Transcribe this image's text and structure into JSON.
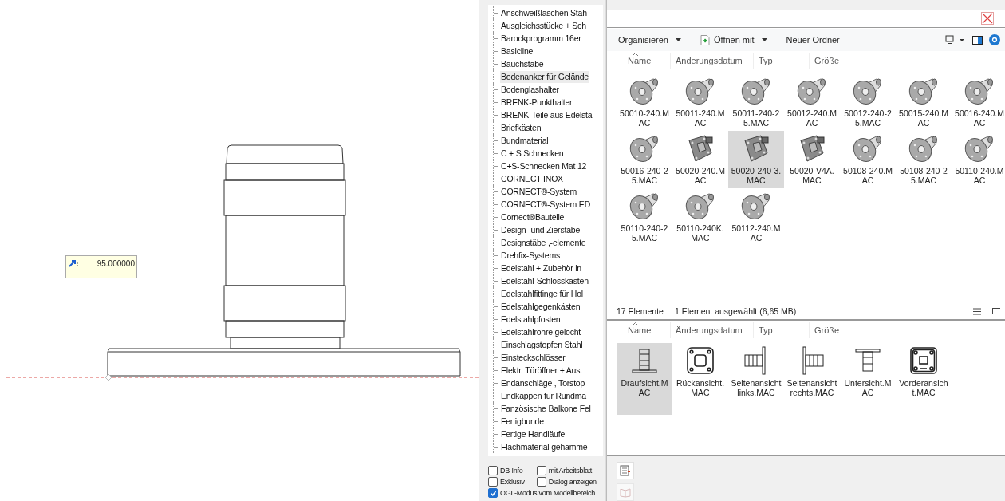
{
  "cad_view": {
    "input_tooltip": {
      "value": "95.000000"
    }
  },
  "tree": {
    "items": [
      {
        "label": "Anschweißlaschen Stah",
        "selected": false
      },
      {
        "label": "Ausgleichsstücke + Sch",
        "selected": false
      },
      {
        "label": "Barockprogramm 16er",
        "selected": false
      },
      {
        "label": "Basicline",
        "selected": false
      },
      {
        "label": "Bauchstäbe",
        "selected": false
      },
      {
        "label": "Bodenanker für Gelände",
        "selected": true
      },
      {
        "label": "Bodenglashalter",
        "selected": false
      },
      {
        "label": "BRENK-Punkthalter",
        "selected": false
      },
      {
        "label": "BRENK-Teile aus Edelsta",
        "selected": false
      },
      {
        "label": "Briefkästen",
        "selected": false
      },
      {
        "label": "Bundmaterial",
        "selected": false
      },
      {
        "label": "C + S Schnecken",
        "selected": false
      },
      {
        "label": "C+S-Schnecken Mat 12",
        "selected": false
      },
      {
        "label": "CORNECT INOX",
        "selected": false
      },
      {
        "label": "CORNECT®-System",
        "selected": false
      },
      {
        "label": "CORNECT®-System ED",
        "selected": false
      },
      {
        "label": "Cornect®Bauteile",
        "selected": false
      },
      {
        "label": "Design- und Zierstäbe",
        "selected": false
      },
      {
        "label": "Designstäbe ,-elemente",
        "selected": false
      },
      {
        "label": "Drehfix-Systems",
        "selected": false
      },
      {
        "label": "Edelstahl + Zubehör in",
        "selected": false
      },
      {
        "label": "Edelstahl-Schlosskästen",
        "selected": false
      },
      {
        "label": "Edelstahlfittinge für Hol",
        "selected": false
      },
      {
        "label": "Edelstahlgegenkästen",
        "selected": false
      },
      {
        "label": "Edelstahlpfosten",
        "selected": false
      },
      {
        "label": "Edelstahlrohre gelocht",
        "selected": false
      },
      {
        "label": "Einschlagstopfen Stahl",
        "selected": false
      },
      {
        "label": "Einsteckschlösser",
        "selected": false
      },
      {
        "label": "Elektr. Türöffner + Aust",
        "selected": false
      },
      {
        "label": "Endanschläge , Torstop",
        "selected": false
      },
      {
        "label": "Endkappen für Rundma",
        "selected": false
      },
      {
        "label": "Fanzösische Balkone Fel",
        "selected": false
      },
      {
        "label": "Fertigbunde",
        "selected": false
      },
      {
        "label": "Fertige Handläufe",
        "selected": false
      },
      {
        "label": "Flachmaterial gehämme",
        "selected": false
      }
    ]
  },
  "options": [
    {
      "label": "DB-Info",
      "checked": false
    },
    {
      "label": "mit Arbeitsblatt",
      "checked": false
    },
    {
      "label": "Exklusiv",
      "checked": false
    },
    {
      "label": "Dialog anzeigen",
      "checked": false
    },
    {
      "label": "OGL-Modus vom Modellbereich",
      "checked": true
    }
  ],
  "explorer": {
    "toolbar": [
      {
        "label": "Organisieren",
        "kind": "menu"
      },
      {
        "label": "Öffnen mit",
        "kind": "open"
      },
      {
        "label": "Neuer Ordner",
        "kind": "button"
      }
    ],
    "columns": [
      "Name",
      "Änderungsdatum",
      "Typ",
      "Größe"
    ],
    "files": [
      {
        "name": "50010-240.MAC",
        "kind": "flange",
        "selected": false
      },
      {
        "name": "50011-240.MAC",
        "kind": "flange",
        "selected": false
      },
      {
        "name": "50011-240-25.MAC",
        "kind": "flange",
        "selected": false
      },
      {
        "name": "50012-240.MAC",
        "kind": "flange",
        "selected": false
      },
      {
        "name": "50012-240-25.MAC",
        "kind": "flange",
        "selected": false
      },
      {
        "name": "50015-240.MAC",
        "kind": "flange",
        "selected": false
      },
      {
        "name": "50016-240.MAC",
        "kind": "flange",
        "selected": false
      },
      {
        "name": "50016-240-25.MAC",
        "kind": "flange",
        "selected": false
      },
      {
        "name": "50020-240.MAC",
        "kind": "plate",
        "selected": false
      },
      {
        "name": "50020-240-3.MAC",
        "kind": "plate",
        "selected": true
      },
      {
        "name": "50020-V4A.MAC",
        "kind": "plate",
        "selected": false
      },
      {
        "name": "50108-240.MAC",
        "kind": "flange",
        "selected": false
      },
      {
        "name": "50108-240-25.MAC",
        "kind": "flange",
        "selected": false
      },
      {
        "name": "50110-240.MAC",
        "kind": "flange",
        "selected": false
      },
      {
        "name": "50110-240-25.MAC",
        "kind": "flange",
        "selected": false
      },
      {
        "name": "50110-240K.MAC",
        "kind": "flange",
        "selected": false
      },
      {
        "name": "50112-240.MAC",
        "kind": "flange",
        "selected": false
      }
    ],
    "status": {
      "count": "17 Elemente",
      "selection": "1 Element ausgewählt (6,65 MB)"
    },
    "preview": {
      "columns": [
        "Name",
        "Änderungsdatum",
        "Typ",
        "Größe"
      ],
      "files": [
        {
          "name": "Draufsicht.MAC",
          "kind": "top",
          "selected": true
        },
        {
          "name": "Rückansicht.MAC",
          "kind": "back",
          "selected": false
        },
        {
          "name": "Seitenansicht links.MAC",
          "kind": "side-left",
          "selected": false
        },
        {
          "name": "Seitenansicht rechts.MAC",
          "kind": "side-right",
          "selected": false
        },
        {
          "name": "Untersicht.MAC",
          "kind": "bottom",
          "selected": false
        },
        {
          "name": "Vorderansicht.MAC",
          "kind": "front",
          "selected": false
        }
      ]
    }
  }
}
